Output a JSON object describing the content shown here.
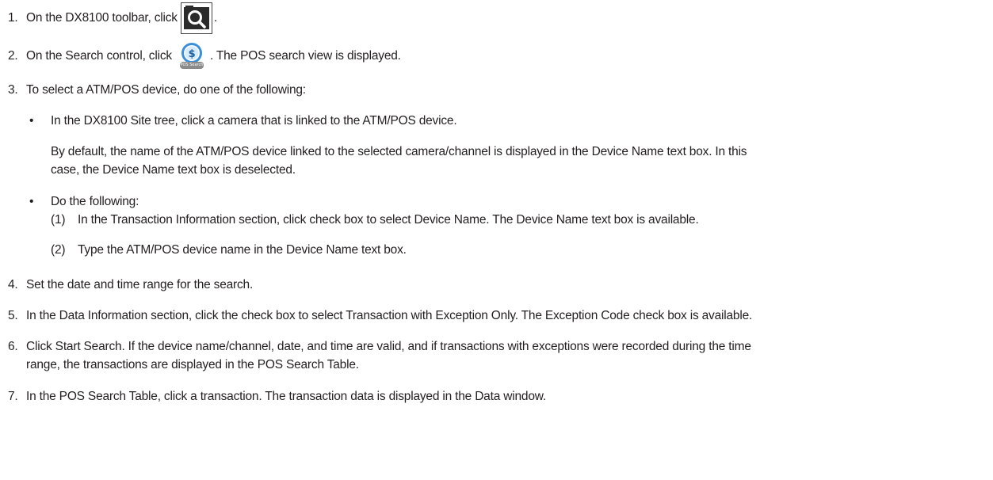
{
  "steps": [
    {
      "num": "1.",
      "text_before": "On the DX8100 toolbar, click",
      "text_after": ".",
      "icon": "search-toolbar-icon"
    },
    {
      "num": "2.",
      "text_before": "On the Search control, click",
      "text_after": ". The POS search view is displayed.",
      "icon": "pos-search-icon",
      "icon_label": "POS Search"
    },
    {
      "num": "3.",
      "text": "To select a ATM/POS device, do one of the following:"
    },
    {
      "num": "4.",
      "text": "Set the date and time range for the search."
    },
    {
      "num": "5.",
      "text": "In the Data Information section, click the check box to select Transaction with Exception Only. The Exception Code check box is available."
    },
    {
      "num": "6.",
      "text_line1": "Click Start Search. If the device name/channel, date, and time are valid, and if transactions with exceptions were recorded during the time",
      "text_line2": "range, the transactions are displayed in the POS Search Table."
    },
    {
      "num": "7.",
      "text": "In the POS Search Table, click a transaction. The transaction data is displayed in the Data window."
    }
  ],
  "options": [
    {
      "bullet": "•",
      "text": "In the DX8100 Site tree, click a camera that is linked to the ATM/POS device.",
      "note_line1": "By default, the name of the ATM/POS device linked to the selected camera/channel is displayed in the Device Name text box. In this",
      "note_line2": "case, the Device Name text box is deselected."
    },
    {
      "bullet": "•",
      "text": "Do the following:",
      "substeps": [
        {
          "num": "(1)",
          "text": "In the Transaction Information section, click check box to select Device Name. The Device Name text box is available."
        },
        {
          "num": "(2)",
          "text": "Type the ATM/POS device name in the Device Name text box."
        }
      ]
    }
  ]
}
